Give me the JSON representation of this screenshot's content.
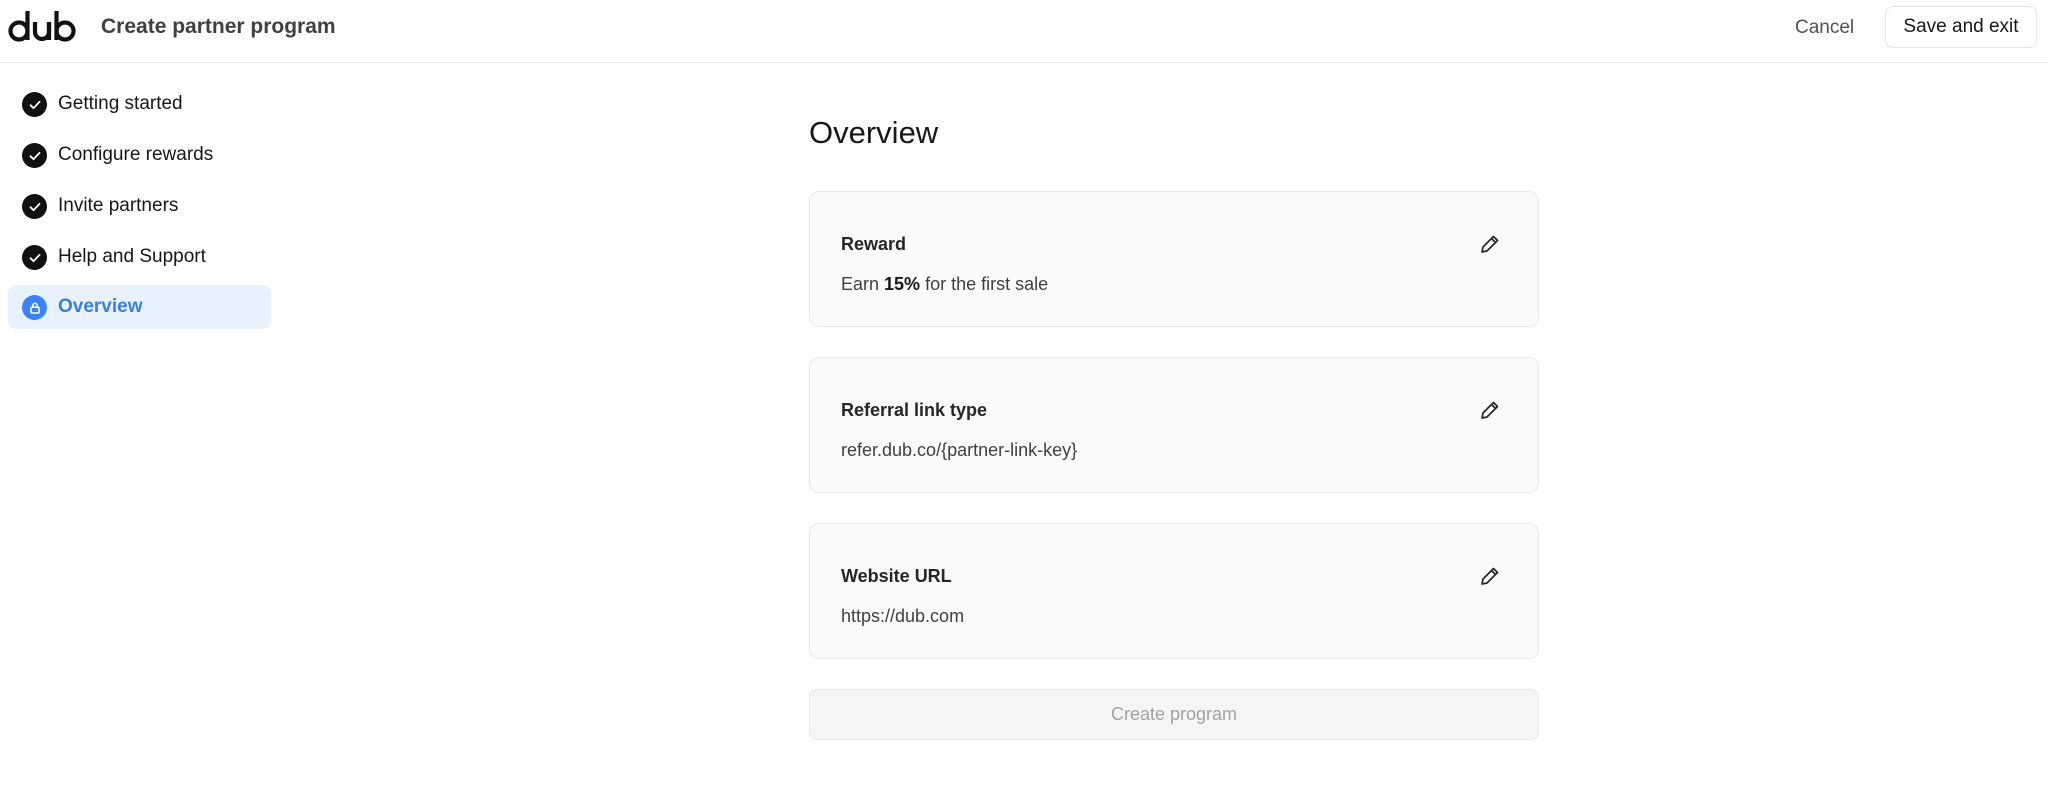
{
  "header": {
    "logo_text": "dub",
    "title": "Create partner program",
    "cancel_label": "Cancel",
    "save_label": "Save and exit"
  },
  "sidebar": {
    "steps": [
      {
        "label": "Getting started",
        "status": "complete",
        "icon": "check-icon"
      },
      {
        "label": "Configure rewards",
        "status": "complete",
        "icon": "check-icon"
      },
      {
        "label": "Invite partners",
        "status": "complete",
        "icon": "check-icon"
      },
      {
        "label": "Help and Support",
        "status": "complete",
        "icon": "check-icon"
      },
      {
        "label": "Overview",
        "status": "active",
        "icon": "lock-icon"
      }
    ]
  },
  "main": {
    "title": "Overview",
    "cards": [
      {
        "label": "Reward",
        "value_prefix": "Earn ",
        "value_bold": "15%",
        "value_suffix": " for the first sale",
        "icon": "pencil-icon"
      },
      {
        "label": "Referral link type",
        "value": "refer.dub.co/{partner-link-key}",
        "icon": "pencil-icon"
      },
      {
        "label": "Website URL",
        "value": "https://dub.com",
        "icon": "pencil-icon"
      }
    ],
    "create_label": "Create program"
  },
  "colors": {
    "accent": "#3b82f6",
    "active_bg": "#e8f2fe",
    "step_complete": "#111111",
    "card_bg": "#fafafa",
    "disabled_text": "#a3a3a3"
  }
}
